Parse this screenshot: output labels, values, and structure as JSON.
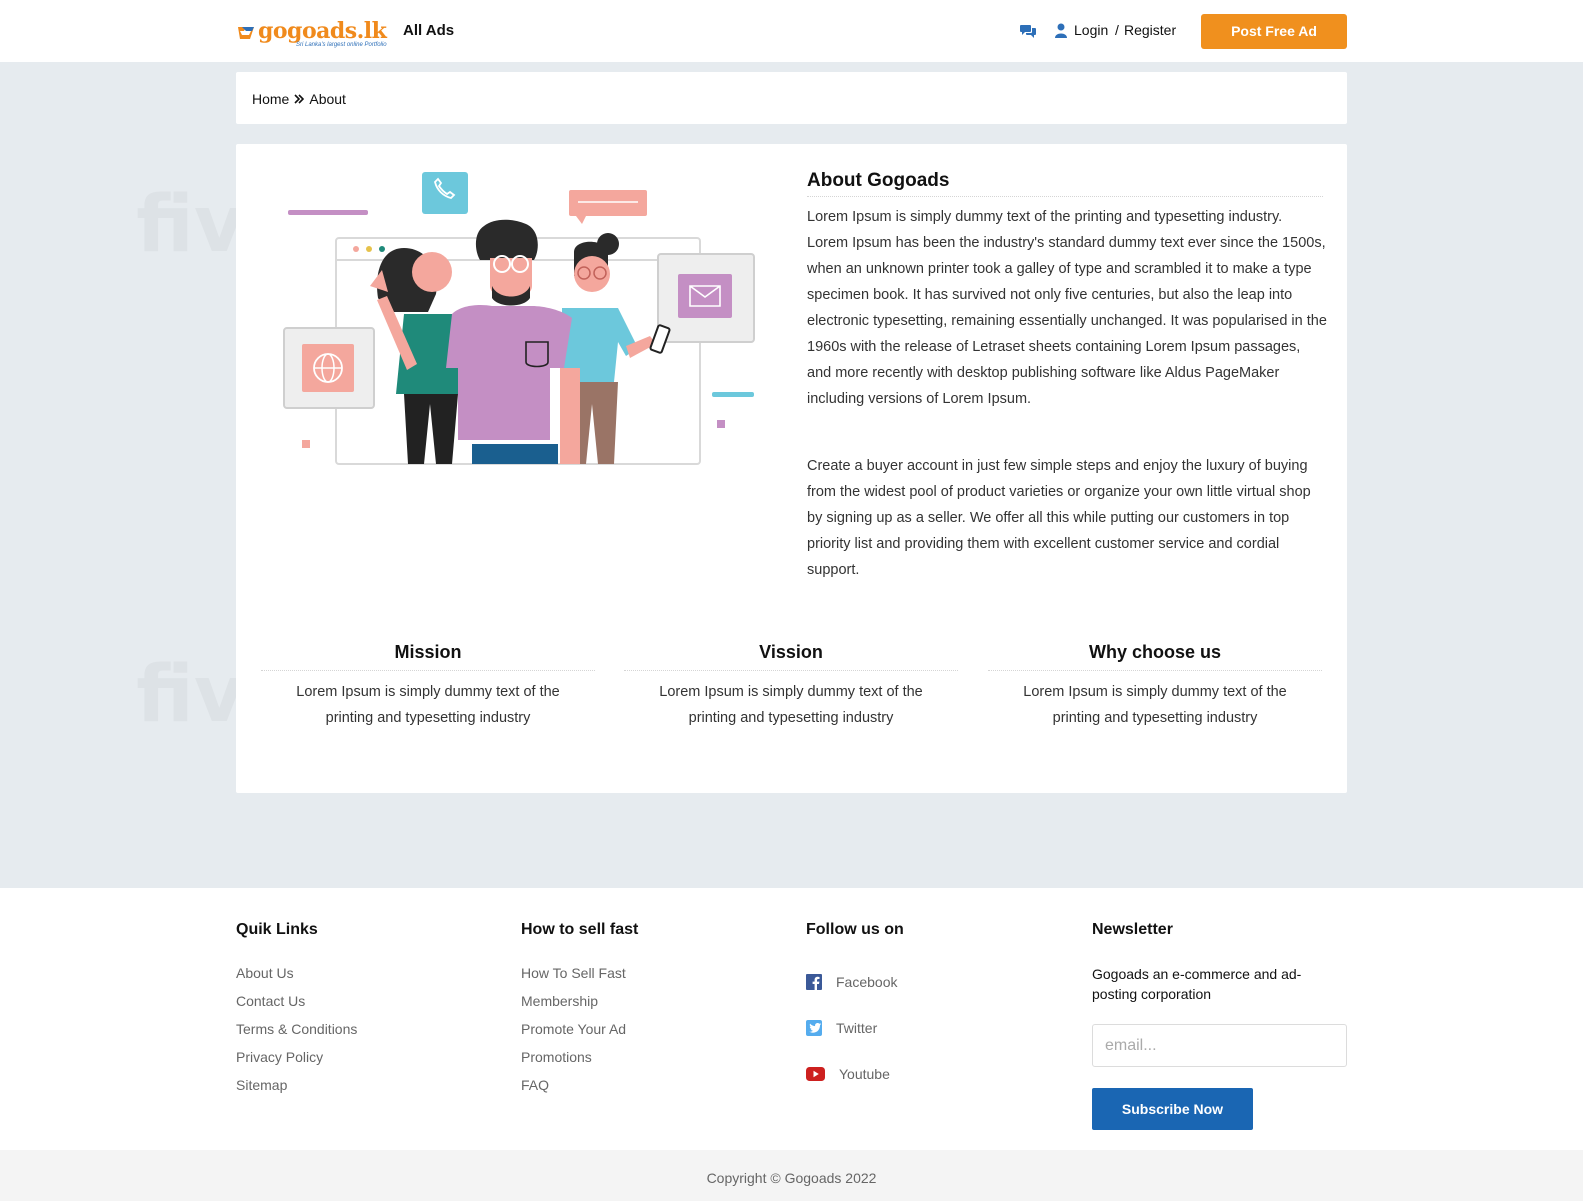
{
  "header": {
    "logo_text": "gogoads.lk",
    "logo_tagline": "Sri Lanka's largest online Portfolio",
    "nav_all_ads": "All Ads",
    "login": "Login",
    "separator": "/",
    "register": "Register",
    "post_button": "Post Free Ad"
  },
  "breadcrumb": {
    "home": "Home",
    "current": "About"
  },
  "about": {
    "title": "About Gogoads",
    "paragraph1": "Lorem Ipsum is simply dummy text of the printing and typesetting industry. Lorem Ipsum has been the industry's standard dummy text ever since the 1500s, when an unknown printer took a galley of type and scrambled it to make a type specimen book. It has survived not only five centuries, but also the leap into electronic typesetting, remaining essentially unchanged. It was popularised in the 1960s with the release of Letraset sheets containing Lorem Ipsum passages, and more recently with desktop publishing software like Aldus PageMaker including versions of Lorem Ipsum.",
    "paragraph2": "Create a buyer account in just few simple steps and enjoy the luxury of buying from the widest pool of product varieties or organize your own little virtual shop by signing up as a seller. We offer all this while putting our customers in top priority list and providing them with excellent customer service and cordial support."
  },
  "columns": [
    {
      "title": "Mission",
      "text": "Lorem Ipsum is simply dummy text of the printing and typesetting industry"
    },
    {
      "title": "Vission",
      "text": "Lorem Ipsum is simply dummy text of the printing and typesetting industry"
    },
    {
      "title": "Why choose us",
      "text": "Lorem Ipsum is simply dummy text of the printing and typesetting industry"
    }
  ],
  "footer": {
    "quick_links": {
      "title": "Quik Links",
      "items": [
        "About Us",
        "Contact Us",
        "Terms & Conditions",
        "Privacy Policy",
        "Sitemap"
      ]
    },
    "sell_fast": {
      "title": "How to sell fast",
      "items": [
        "How To Sell Fast",
        "Membership",
        "Promote Your Ad",
        "Promotions",
        "FAQ"
      ]
    },
    "follow": {
      "title": "Follow us on",
      "items": [
        {
          "label": "Facebook",
          "icon": "facebook-icon"
        },
        {
          "label": "Twitter",
          "icon": "twitter-icon"
        },
        {
          "label": "Youtube",
          "icon": "youtube-icon"
        }
      ]
    },
    "newsletter": {
      "title": "Newsletter",
      "text": "Gogoads an e-commerce and ad-posting corporation",
      "placeholder": "email...",
      "button": "Subscribe Now"
    },
    "copyright": "Copyright © Gogoads 2022"
  },
  "watermark": "fiverr.",
  "colors": {
    "accent_orange": "#f0901e",
    "primary_blue": "#1a66b3",
    "page_bg": "#e6ebef"
  }
}
